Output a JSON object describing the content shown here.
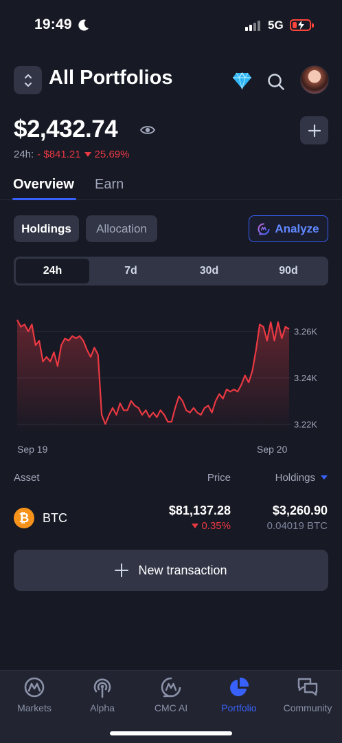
{
  "status_bar": {
    "time": "19:49",
    "network": "5G"
  },
  "header": {
    "title": "All Portfolios"
  },
  "portfolio": {
    "balance": "$2,432.74",
    "change_label": "24h:",
    "change_amount": "- $841.21",
    "change_percent": "25.69%"
  },
  "tabs": [
    {
      "label": "Overview",
      "active": true
    },
    {
      "label": "Earn",
      "active": false
    }
  ],
  "view_toggle": {
    "holdings": "Holdings",
    "allocation": "Allocation",
    "analyze": "Analyze"
  },
  "time_ranges": [
    {
      "label": "24h",
      "active": true
    },
    {
      "label": "7d",
      "active": false
    },
    {
      "label": "30d",
      "active": false
    },
    {
      "label": "90d",
      "active": false
    }
  ],
  "chart_data": {
    "type": "line",
    "x_labels": [
      "Sep 19",
      "Sep 20"
    ],
    "y_ticks": [
      "3.26K",
      "3.24K",
      "3.22K"
    ],
    "y_tick_values": [
      3260,
      3240,
      3220
    ],
    "ylim": [
      3216,
      3270
    ],
    "color": "#ea3943",
    "series": [
      {
        "values": [
          3265,
          3262,
          3263,
          3260,
          3263,
          3254,
          3256,
          3247,
          3249,
          3247,
          3251,
          3245,
          3254,
          3257,
          3256,
          3258,
          3257,
          3258,
          3256,
          3252,
          3249,
          3253,
          3250,
          3224,
          3220,
          3224,
          3227,
          3224,
          3229,
          3226,
          3226,
          3230,
          3228,
          3227,
          3224,
          3226,
          3223,
          3225,
          3223,
          3226,
          3224,
          3221,
          3221,
          3227,
          3232,
          3230,
          3226,
          3225,
          3227,
          3225,
          3224,
          3227,
          3228,
          3225,
          3230,
          3233,
          3231,
          3235,
          3234,
          3235,
          3234,
          3237,
          3241,
          3238,
          3243,
          3252,
          3263,
          3262,
          3256,
          3264,
          3256,
          3264,
          3257,
          3262,
          3261
        ]
      }
    ]
  },
  "assets_table": {
    "headers": {
      "asset": "Asset",
      "price": "Price",
      "holdings": "Holdings"
    },
    "rows": [
      {
        "symbol": "BTC",
        "price": "$81,137.28",
        "change": "0.35%",
        "holdings_value": "$3,260.90",
        "holdings_qty": "0.04019 BTC"
      }
    ]
  },
  "new_transaction": "New transaction",
  "bottom_nav": [
    {
      "label": "Markets",
      "icon": "markets-icon",
      "active": false
    },
    {
      "label": "Alpha",
      "icon": "alpha-icon",
      "active": false
    },
    {
      "label": "CMC AI",
      "icon": "cmc-ai-icon",
      "active": false
    },
    {
      "label": "Portfolio",
      "icon": "portfolio-icon",
      "active": true
    },
    {
      "label": "Community",
      "icon": "community-icon",
      "active": false
    }
  ],
  "colors": {
    "accent": "#3861fb",
    "negative": "#ea3943",
    "background": "#171924",
    "surface": "#323546"
  }
}
